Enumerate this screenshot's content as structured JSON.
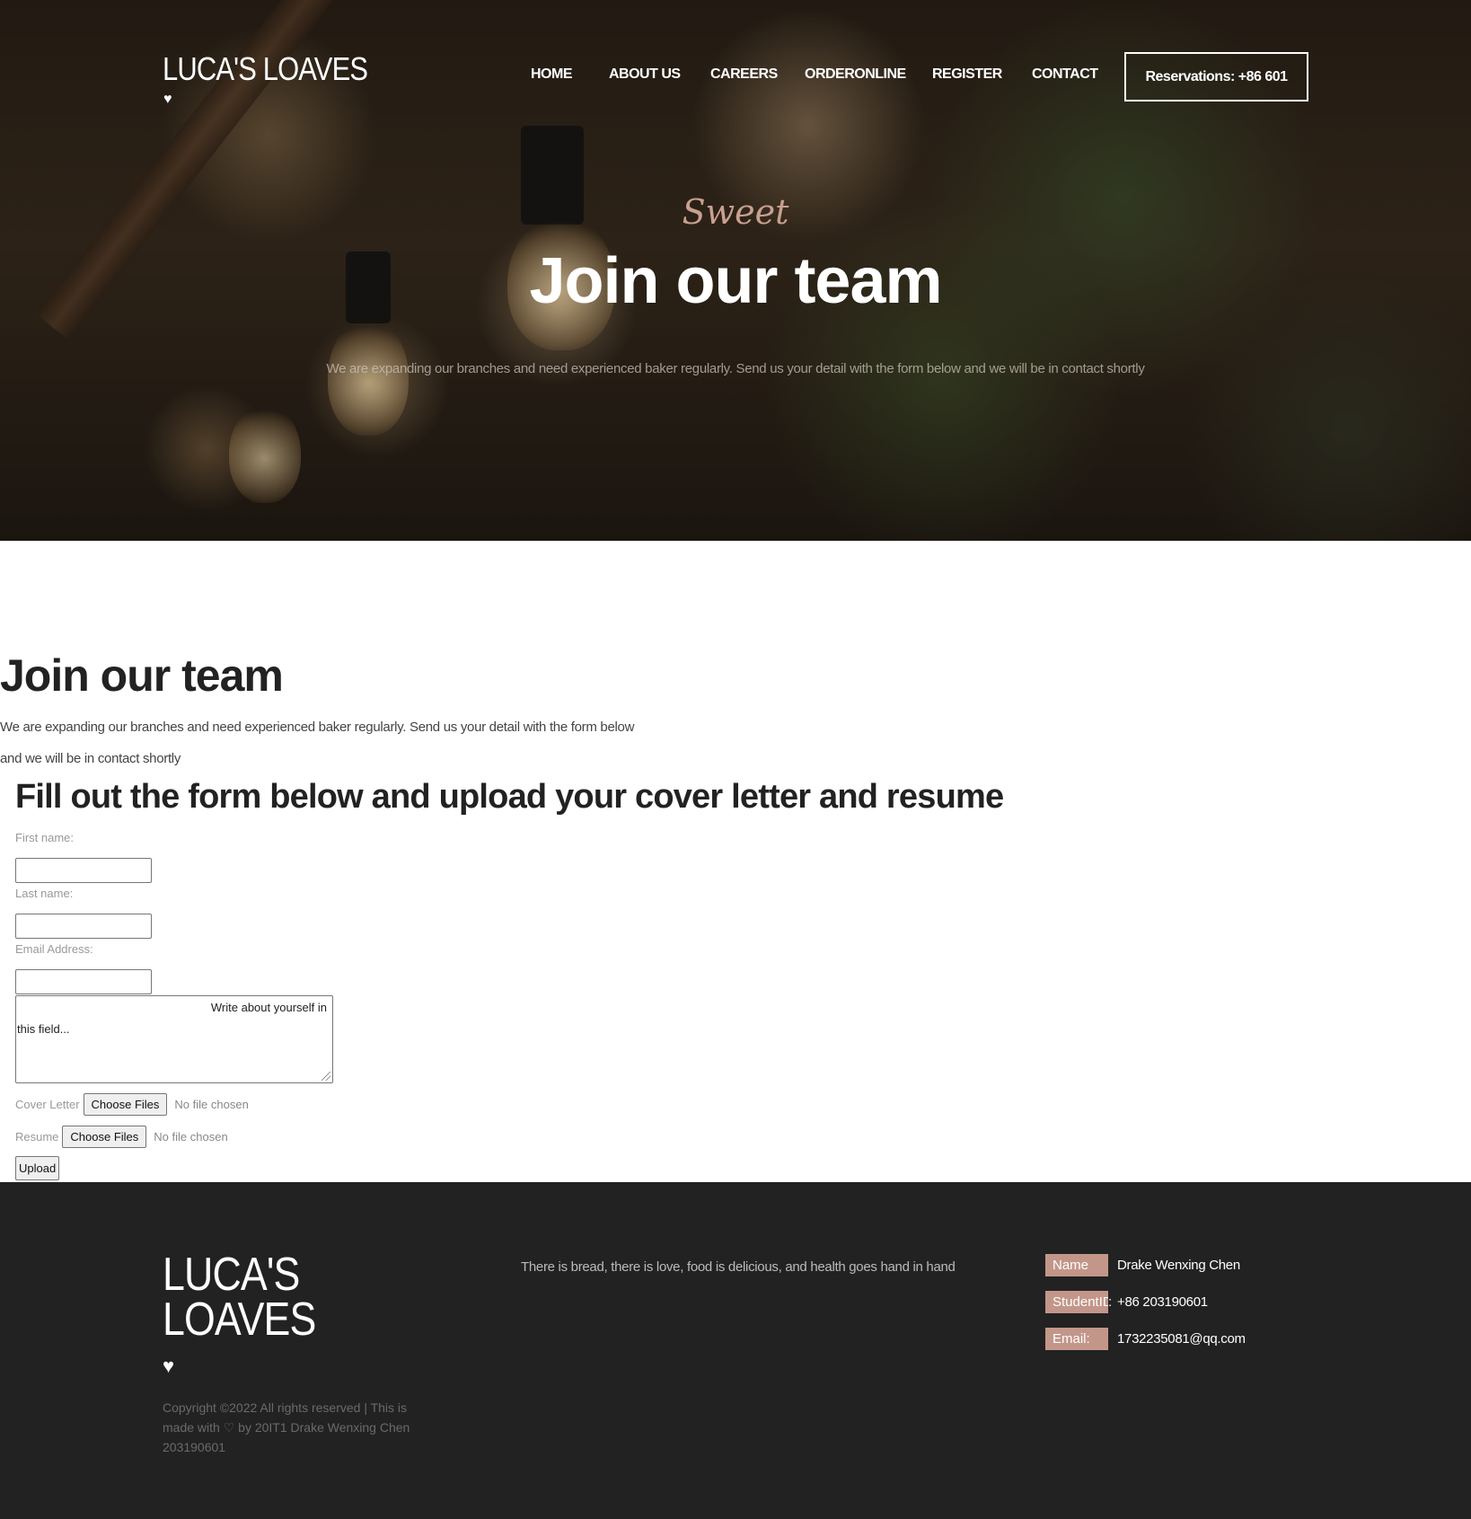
{
  "brand": {
    "name": "LUCA'S LOAVES",
    "heart": "♥"
  },
  "nav": {
    "items": [
      {
        "label": "HOME"
      },
      {
        "label": "ABOUT US"
      },
      {
        "label": "CAREERS"
      },
      {
        "label": "ORDERONLINE"
      },
      {
        "label": "REGISTER"
      },
      {
        "label": "CONTACT"
      }
    ],
    "reservation": "Reservations: +86 601"
  },
  "hero": {
    "script_text": "Sweet",
    "title": "Join our team",
    "subtitle": "We are expanding our branches and need experienced baker regularly. Send us your detail with the form below and we will be in contact shortly"
  },
  "main": {
    "title": "Join our team",
    "intro_line1": "We are expanding our branches and need experienced baker regularly. Send us your detail with the form below",
    "intro_line2": "and we will be in contact shortly",
    "form_title": "Fill out the form below and upload your cover letter and resume"
  },
  "form": {
    "first_name_label": "First name:",
    "first_name_value": "",
    "last_name_label": "Last name:",
    "last_name_value": "",
    "email_label": "Email Address:",
    "email_value": "",
    "about_line1": "Write about yourself in",
    "about_line2": "this field...",
    "cover_letter_label": "Cover Letter",
    "resume_label": "Resume",
    "choose_files": "Choose Files",
    "no_file": "No file chosen",
    "upload": "Upload"
  },
  "footer": {
    "logo_line1": "LUCA'S",
    "logo_line2": "LOAVES",
    "heart": "♥",
    "copyright_line1": "Copyright ©2022 All rights reserved | This is",
    "copyright_made_with": "made with",
    "copyright_by": "by 20IT1 Drake Wenxing Chen",
    "copyright_line3": "203190601",
    "tagline": "There is bread, there is love, food is delicious, and health goes hand in hand",
    "info": [
      {
        "label": "Name",
        "colon": "",
        "value": "Drake Wenxing Chen"
      },
      {
        "label": "StudentID",
        "colon": ":",
        "value": "+86 203190601"
      },
      {
        "label": "Email:",
        "colon": "",
        "value": "1732235081@qq.com"
      }
    ]
  },
  "colors": {
    "accent": "#c3968a",
    "footer_bg": "#222222",
    "script": "#c8a090"
  }
}
